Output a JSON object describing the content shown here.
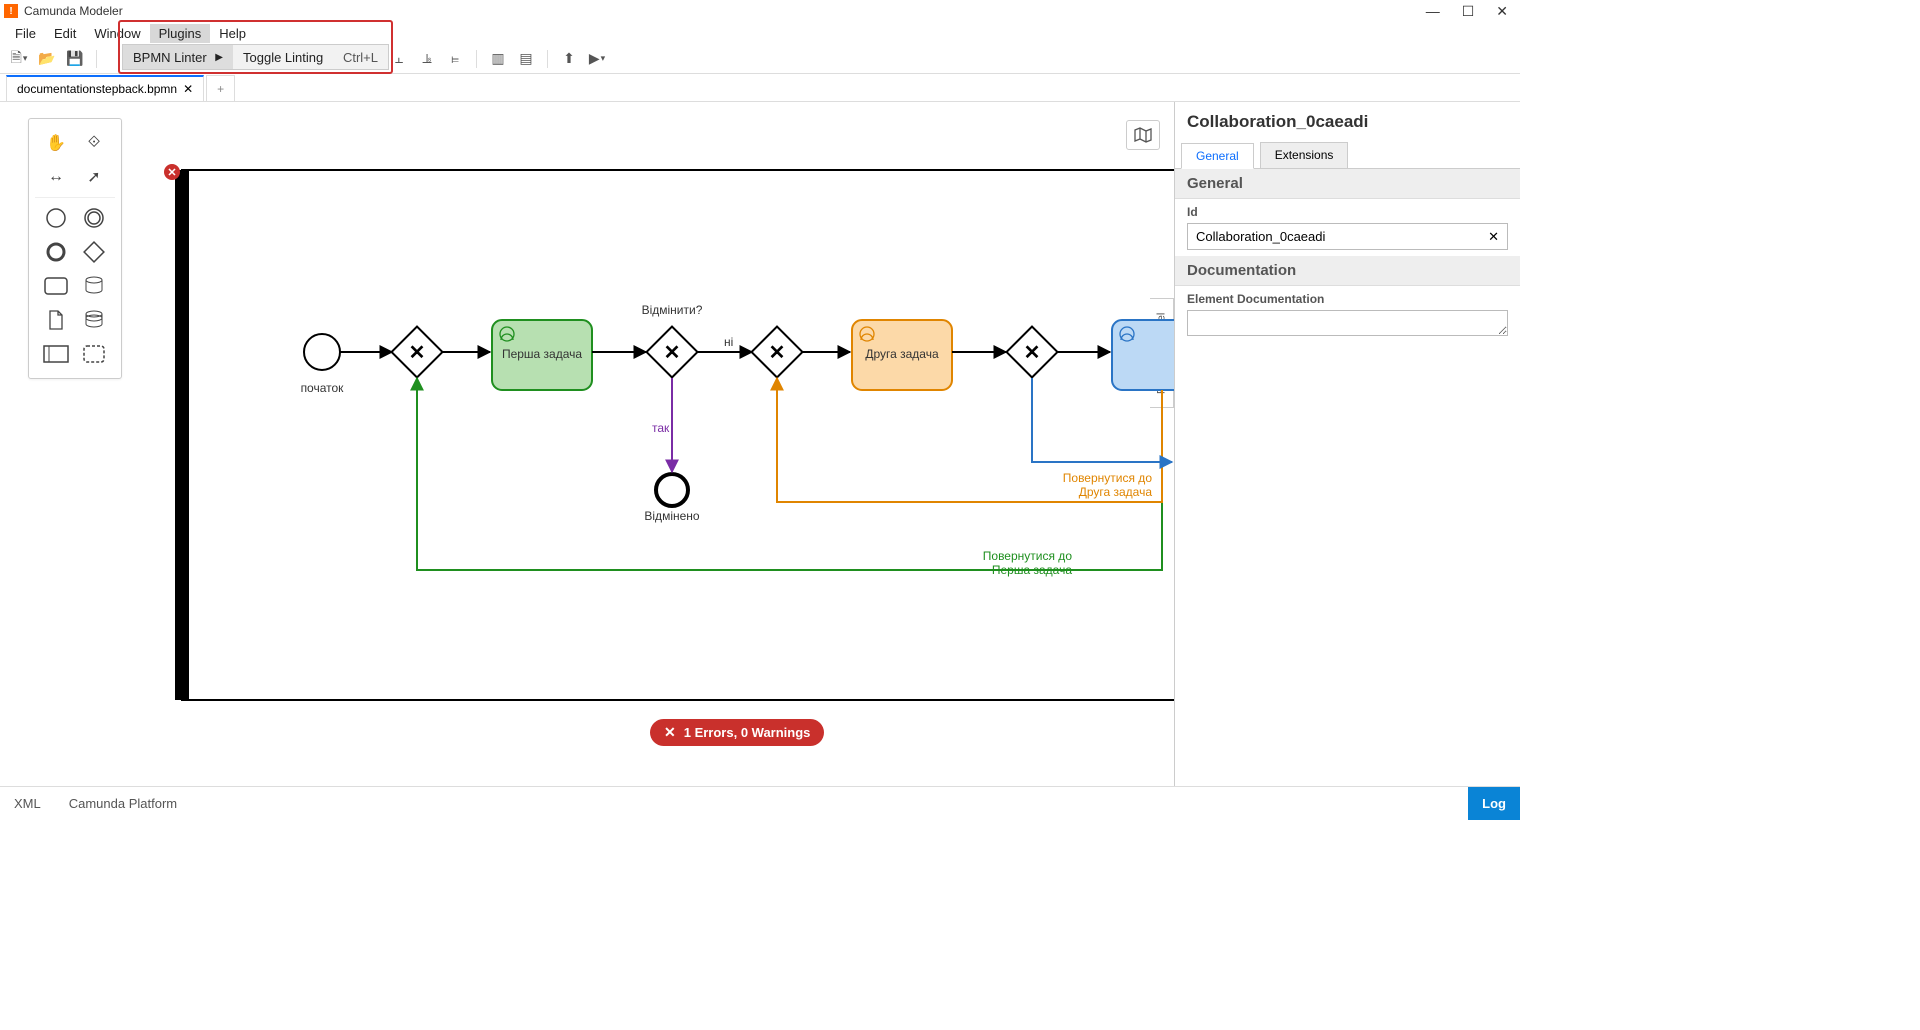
{
  "app": {
    "title": "Camunda Modeler"
  },
  "menu": {
    "file": "File",
    "edit": "Edit",
    "window": "Window",
    "plugins": "Plugins",
    "help": "Help"
  },
  "plugins_menu": {
    "linter": "BPMN Linter",
    "toggle": "Toggle Linting",
    "shortcut": "Ctrl+L"
  },
  "doc_tab": {
    "name": "documentationstepback.bpmn"
  },
  "props": {
    "title": "Collaboration_0caeadi",
    "tab_general": "General",
    "tab_extensions": "Extensions",
    "section_general": "General",
    "id_label": "Id",
    "id_value": "Collaboration_0caeadi",
    "section_doc": "Documentation",
    "doc_label": "Element Documentation",
    "doc_value": ""
  },
  "handle": {
    "label": "Properties Panel"
  },
  "lint": {
    "text": "1 Errors, 0 Warnings"
  },
  "footer": {
    "xml": "XML",
    "platform": "Camunda Platform",
    "log": "Log"
  },
  "bpmn": {
    "start_label": "початок",
    "task1": "Перша задача",
    "task2": "Друга задача",
    "gw_label": "Відмінити?",
    "flow_no": "ні",
    "flow_yes": "так",
    "end_cancel": "Відмінено",
    "return1": "Повернутися до\nПерша задача",
    "return2": "Повернутися до\nДруга задача"
  }
}
